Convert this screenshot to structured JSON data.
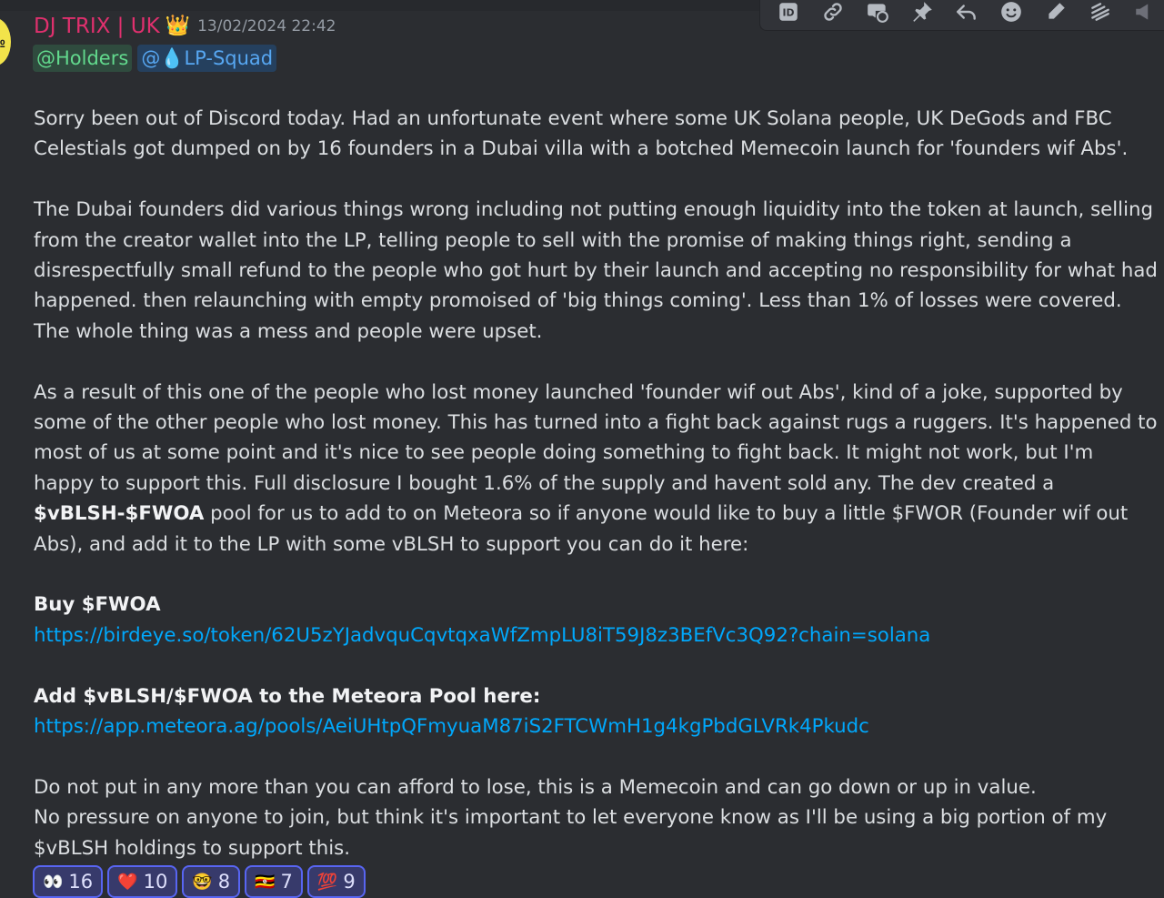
{
  "message": {
    "username": "DJ TRIX | UK",
    "crown": "👑",
    "timestamp": "13/02/2024 22:42",
    "avatar_glyph": "№",
    "mentions": [
      "@Holders",
      "@💧LP-Squad"
    ],
    "p1": "Sorry been out of Discord today. Had an unfortunate event where some UK Solana people, UK DeGods and FBC Celestials got dumped on by 16 founders in a Dubai villa with a botched Memecoin launch for 'founders wif Abs'.",
    "p2": "The Dubai founders did various things wrong including not putting enough liquidity into the token at launch, selling from the creator wallet into the LP, telling people to sell with the promise of making things right, sending a disrespectfully small refund to the people who got hurt by their launch and accepting no responsibility for what had happened. then relaunching with empty promoised of 'big things coming'. Less than 1% of losses were covered. The whole thing was a mess and people were upset.",
    "p3_before": "As a result of this one of the people who lost money launched 'founder wif out Abs', kind of a joke, supported by some of the other people who lost money. This has turned into a fight back against rugs a ruggers. It's happened to most of us at some point and it's nice to see people doing something to fight back. It might not work, but I'm happy to support this. Full disclosure I bought 1.6% of the supply and havent sold any.  The dev created a ",
    "p3_bold": "$vBLSH-$FWOA",
    "p3_after": " pool for us to add to on Meteora so if anyone would like to buy a little $FWOR (Founder wif out Abs), and add it to the LP with some vBLSH to support you can do it here:",
    "buy_heading": "Buy $FWOA",
    "buy_link": "https://birdeye.so/token/62U5zYJadvquCqvtqxaWfZmpLU8iT59J8z3BEfVc3Q92?chain=solana",
    "add_heading": "Add $vBLSH/$FWOA to the Meteora Pool here:",
    "add_link": "https://app.meteora.ag/pools/AeiUHtpQFmyuaM87iS2FTCWmH1g4kgPbdGLVRk4Pkudc",
    "p_final_1": "Do not put in any more than you can afford to lose, this is a Memecoin and can go down or up in value.",
    "p_final_2": "No pressure on anyone to join, but think it's important to let everyone know as I'll be using a big portion of my $vBLSH holdings to support this."
  },
  "reactions": [
    {
      "emoji": "👀",
      "count": "16"
    },
    {
      "emoji": "❤️",
      "count": "10"
    },
    {
      "emoji": "🤓",
      "count": "8"
    },
    {
      "emoji": "🇺🇬",
      "count": "7"
    },
    {
      "emoji": "💯",
      "count": "9"
    }
  ],
  "toolbar_icons": [
    "id-icon",
    "link-icon",
    "thread-icon",
    "pin-icon",
    "reply-icon",
    "emoji-icon",
    "edit-icon",
    "more-icon",
    "speaker-icon"
  ],
  "colors": {
    "background": "#2b2d31",
    "username": "#e0306e",
    "link": "#00a8fc",
    "mention_holders": "#62d98d",
    "mention_squad": "#57a7f2",
    "reaction_border": "#5865f2"
  }
}
